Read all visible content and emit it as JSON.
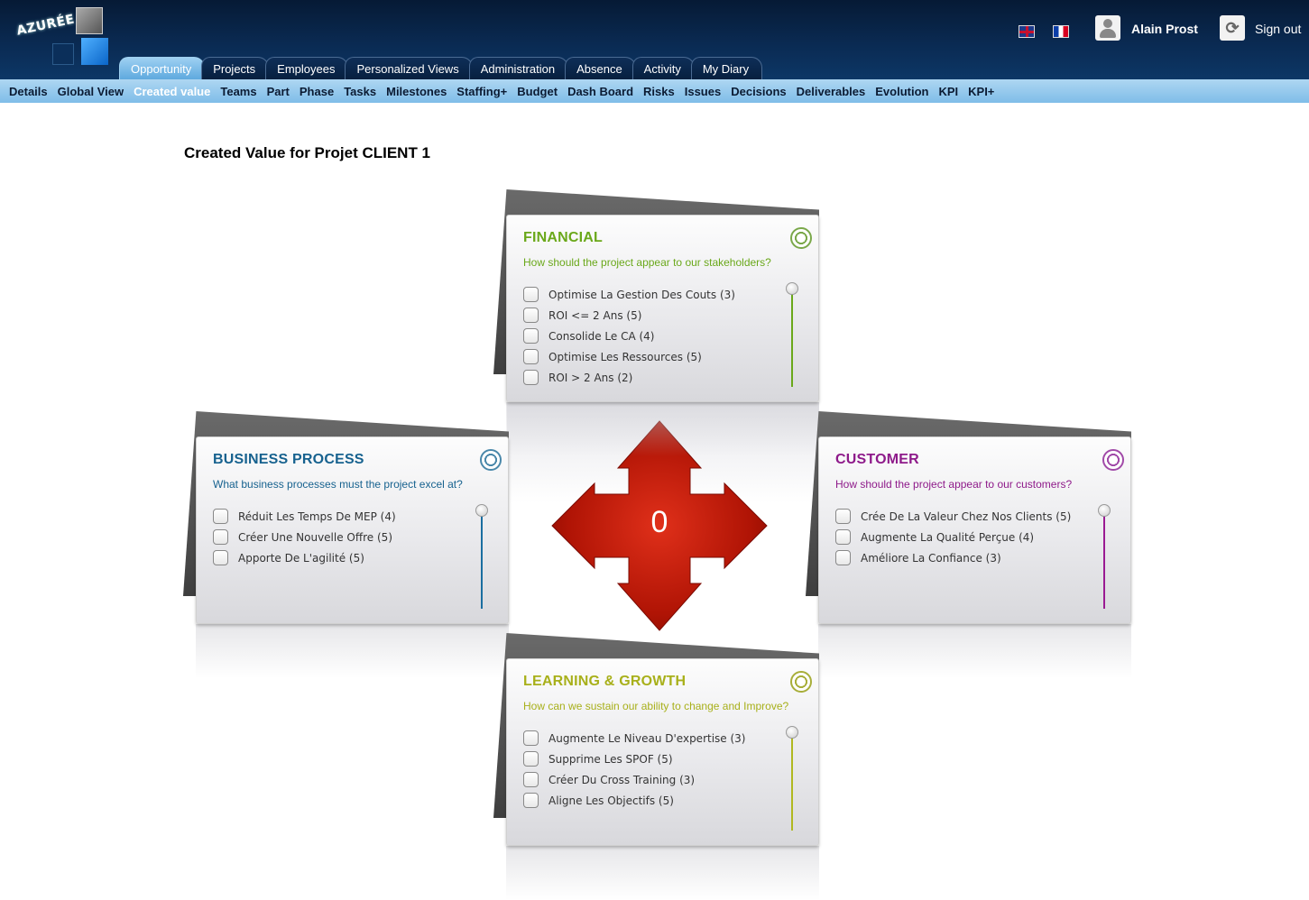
{
  "header": {
    "logo_text": "AZURÉE",
    "user_name": "Alain Prost",
    "signout_label": "Sign out"
  },
  "main_tabs": [
    {
      "label": "Opportunity",
      "active": true
    },
    {
      "label": "Projects"
    },
    {
      "label": "Employees"
    },
    {
      "label": "Personalized Views"
    },
    {
      "label": "Administration"
    },
    {
      "label": "Absence"
    },
    {
      "label": "Activity"
    },
    {
      "label": "My Diary"
    }
  ],
  "sub_nav": [
    {
      "label": "Details"
    },
    {
      "label": "Global View"
    },
    {
      "label": "Created value",
      "active": true
    },
    {
      "label": "Teams"
    },
    {
      "label": "Part"
    },
    {
      "label": "Phase"
    },
    {
      "label": "Tasks"
    },
    {
      "label": "Milestones"
    },
    {
      "label": "Staffing+"
    },
    {
      "label": "Budget"
    },
    {
      "label": "Dash Board"
    },
    {
      "label": "Risks"
    },
    {
      "label": "Issues"
    },
    {
      "label": "Decisions"
    },
    {
      "label": "Deliverables"
    },
    {
      "label": "Evolution"
    },
    {
      "label": "KPI"
    },
    {
      "label": "KPI+"
    }
  ],
  "page": {
    "title": "Created Value for Projet CLIENT 1",
    "score": "0"
  },
  "cards": {
    "financial": {
      "title": "FINANCIAL",
      "subtitle": "How should the project appear to our stakeholders?",
      "color": "#6aa81a",
      "items": [
        "Optimise La Gestion Des Couts (3)",
        "ROI <= 2 Ans (5)",
        "Consolide Le CA (4)",
        "Optimise Les Ressources (5)",
        "ROI > 2 Ans (2)"
      ]
    },
    "business": {
      "title": "BUSINESS PROCESS",
      "subtitle": "What business processes must the project excel at?",
      "color": "#17628f",
      "items": [
        "Réduit Les Temps De MEP (4)",
        "Créer Une Nouvelle Offre (5)",
        "Apporte De L'agilité (5)"
      ]
    },
    "customer": {
      "title": "CUSTOMER",
      "subtitle": "How should the project appear to our customers?",
      "color": "#8e1a8a",
      "items": [
        "Crée De La Valeur Chez Nos Clients (5)",
        "Augmente La Qualité Perçue (4)",
        "Améliore La Confiance (3)"
      ]
    },
    "learning": {
      "title": "LEARNING & GROWTH",
      "subtitle": "How can we sustain our ability to change and Improve?",
      "color": "#a8b01a",
      "items": [
        "Augmente Le Niveau D'expertise (3)",
        "Supprime Les SPOF (5)",
        "Créer Du Cross Training (3)",
        "Aligne Les Objectifs (5)"
      ]
    }
  },
  "colors": {
    "header_bg": "#0a2a52",
    "subnav_bg": "#7fbde8",
    "arrow_red": "#c01a08"
  },
  "icons": [
    "uk-flag-icon",
    "france-flag-icon",
    "user-icon",
    "sign-out-icon",
    "ring-icon",
    "checkbox-icon",
    "four-way-arrow-icon"
  ]
}
